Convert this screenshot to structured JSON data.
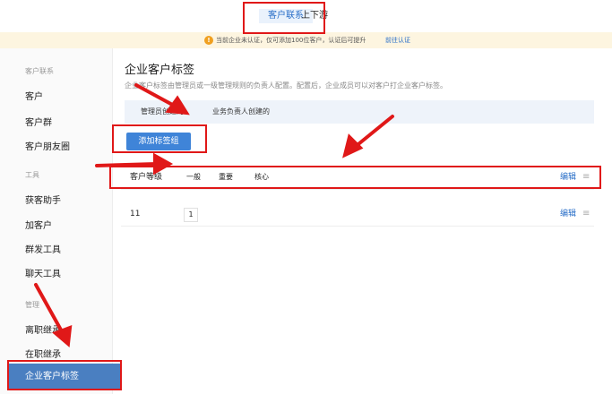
{
  "top_nav": {
    "tabs": [
      "客户联系",
      "上下游"
    ]
  },
  "notice": {
    "icon": "warning-icon",
    "text": "当前企业未认证，仅可添加100位客户，认证后可提升",
    "link": "前往认证"
  },
  "sidebar": {
    "sections": [
      {
        "heading": "客户联系",
        "items": [
          "客户",
          "客户群",
          "客户朋友圈"
        ]
      },
      {
        "heading": "工具",
        "items": [
          "获客助手",
          "加客户",
          "群发工具",
          "聊天工具"
        ]
      },
      {
        "heading": "管理",
        "items": [
          "离职继承",
          "在职继承",
          "企业客户标签"
        ]
      }
    ],
    "active_item": "企业客户标签"
  },
  "main": {
    "title": "企业客户标签",
    "description": "企业客户标签由管理员或一级管理规则的负责人配置。配置后，企业成员可以对客户打企业客户标签。",
    "tabs": [
      "管理员创建的",
      "业务负责人创建的"
    ],
    "add_button": "添加标签组",
    "groups": [
      {
        "name": "客户等级",
        "tags": [
          "一般",
          "重要",
          "核心"
        ],
        "edit": "编辑"
      },
      {
        "name": "11",
        "tags": [
          "1"
        ],
        "edit": "编辑"
      }
    ]
  },
  "colors": {
    "accent": "#3f84d8",
    "sidebar_active": "#4a7fc1",
    "annotation": "#e01818"
  }
}
